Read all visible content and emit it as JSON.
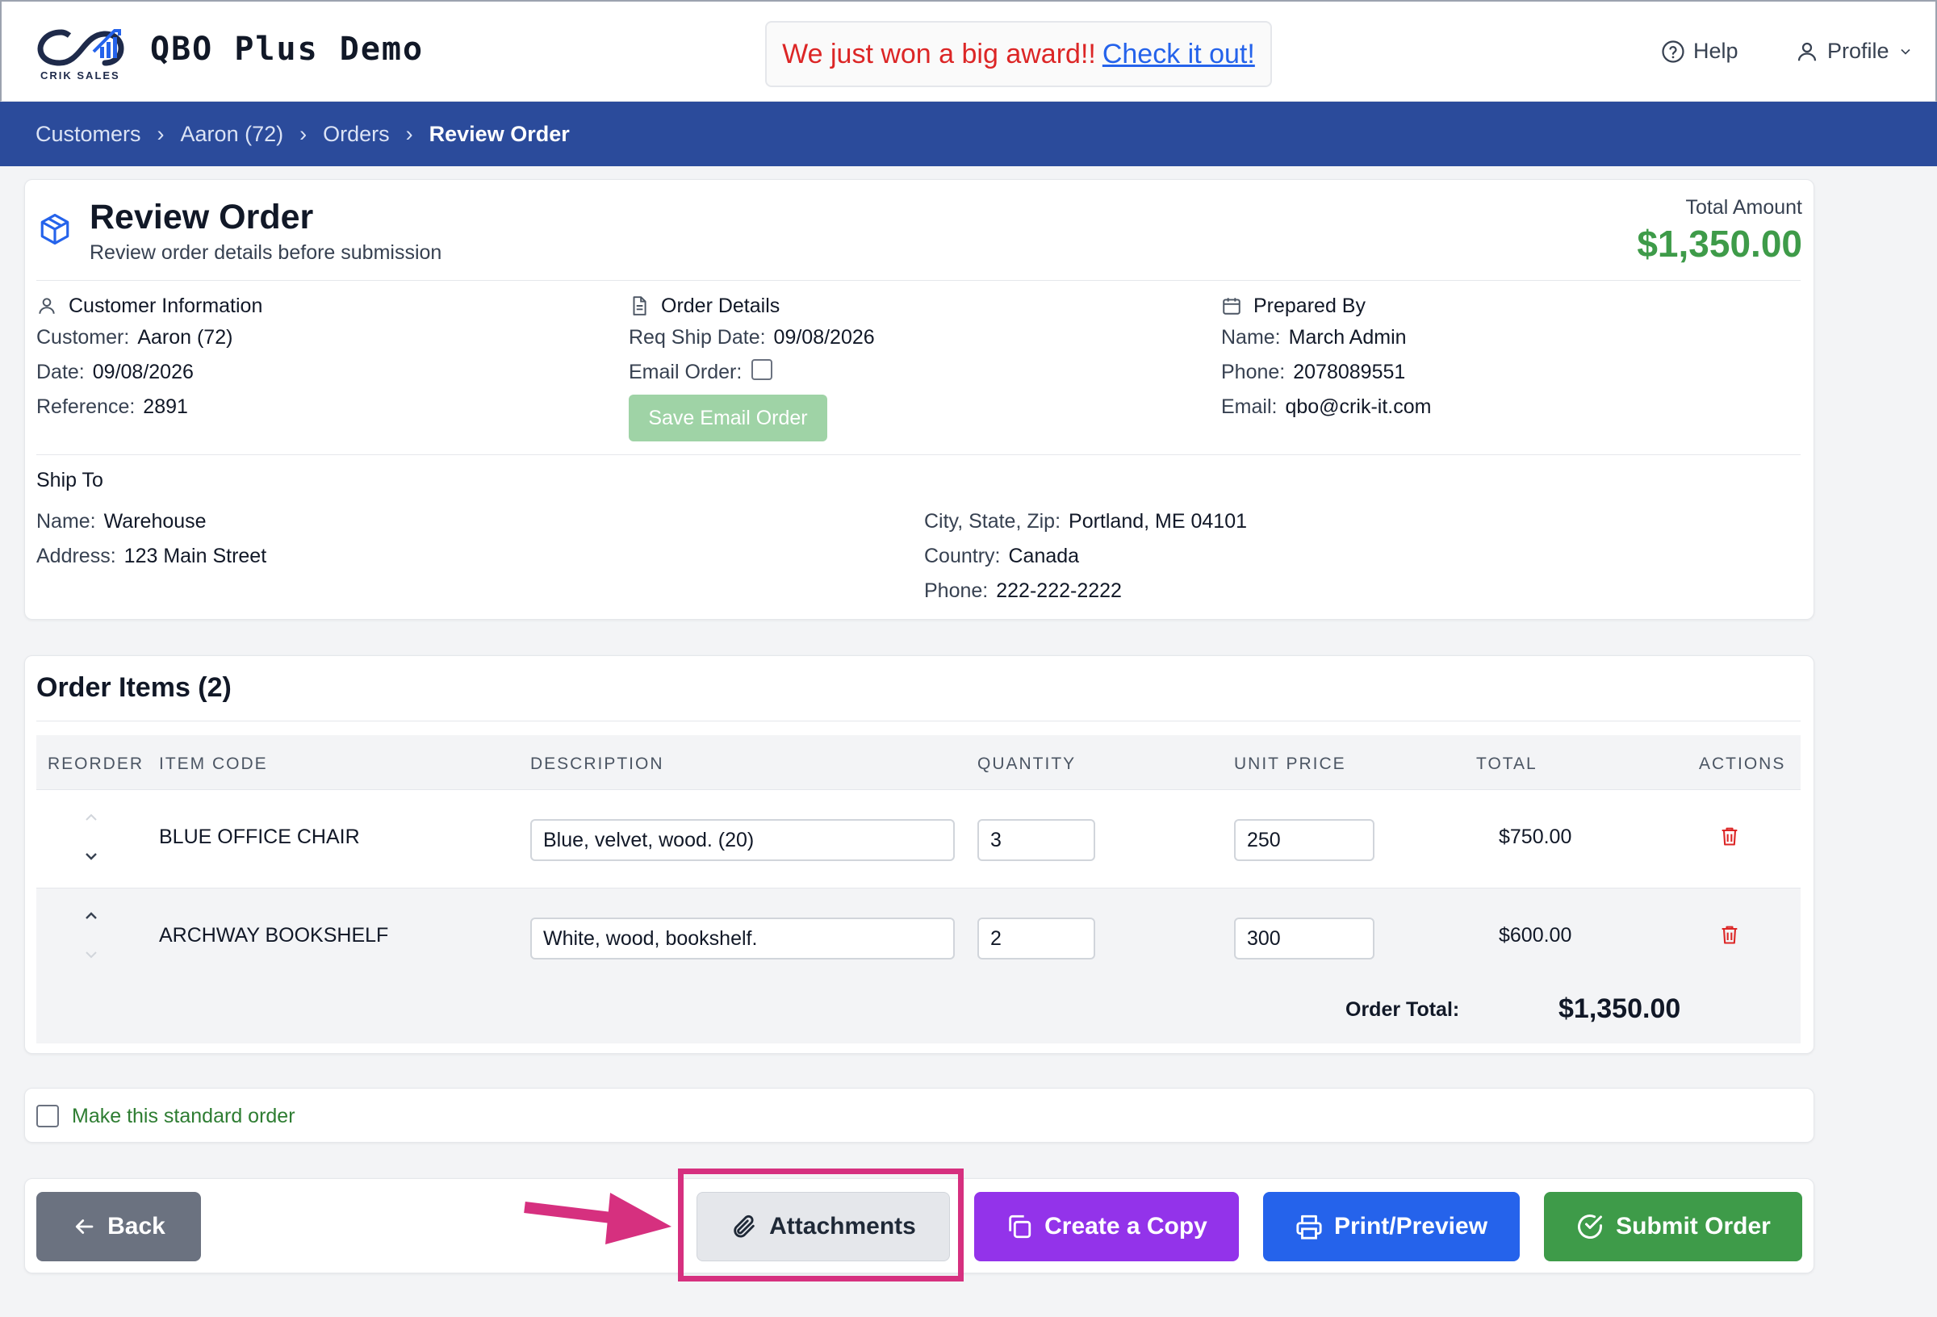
{
  "header": {
    "app_title": "QBO Plus Demo",
    "logo_caption": "CRIK SALES",
    "banner_message": "We just won a big award!!",
    "banner_link": "Check it out!",
    "help_label": "Help",
    "profile_label": "Profile"
  },
  "breadcrumb": [
    "Customers",
    "Aaron (72)",
    "Orders",
    "Review Order"
  ],
  "review": {
    "title": "Review Order",
    "subtitle": "Review order details before submission",
    "total_label": "Total Amount",
    "total_value": "$1,350.00",
    "customer_info": {
      "heading": "Customer Information",
      "customer_label": "Customer:",
      "customer_value": "Aaron (72)",
      "date_label": "Date:",
      "date_value": "09/08/2026",
      "reference_label": "Reference:",
      "reference_value": "2891"
    },
    "order_details": {
      "heading": "Order Details",
      "ship_date_label": "Req Ship Date:",
      "ship_date_value": "09/08/2026",
      "email_order_label": "Email Order:",
      "email_order_checked": false,
      "save_email_button": "Save Email Order"
    },
    "prepared_by": {
      "heading": "Prepared By",
      "name_label": "Name:",
      "name_value": "March Admin",
      "phone_label": "Phone:",
      "phone_value": "2078089551",
      "email_label": "Email:",
      "email_value": "qbo@crik-it.com"
    },
    "ship_to": {
      "heading": "Ship To",
      "name_label": "Name:",
      "name_value": "Warehouse",
      "address_label": "Address:",
      "address_value": "123 Main Street",
      "city_label": "City, State, Zip:",
      "city_value": "Portland, ME 04101",
      "country_label": "Country:",
      "country_value": "Canada",
      "phone_label": "Phone:",
      "phone_value": "222-222-2222"
    }
  },
  "items": {
    "title": "Order Items (2)",
    "columns": [
      "REORDER",
      "ITEM CODE",
      "DESCRIPTION",
      "QUANTITY",
      "UNIT PRICE",
      "TOTAL",
      "ACTIONS"
    ],
    "rows": [
      {
        "code": "BLUE OFFICE CHAIR",
        "description": "Blue, velvet, wood. (20)",
        "quantity": "3",
        "unit_price": "250",
        "total": "$750.00"
      },
      {
        "code": "ARCHWAY BOOKSHELF",
        "description": "White, wood, bookshelf.",
        "quantity": "2",
        "unit_price": "300",
        "total": "$600.00"
      }
    ],
    "order_total_label": "Order Total:",
    "order_total_value": "$1,350.00"
  },
  "standard_order": {
    "label": "Make this standard order",
    "checked": false
  },
  "actions": {
    "back": "Back",
    "attachments": "Attachments",
    "copy": "Create a Copy",
    "print": "Print/Preview",
    "submit": "Submit Order"
  },
  "colors": {
    "brand_bar": "#2b4b9b",
    "total_green": "#3e9b49",
    "annotation_pink": "#d6307f"
  }
}
